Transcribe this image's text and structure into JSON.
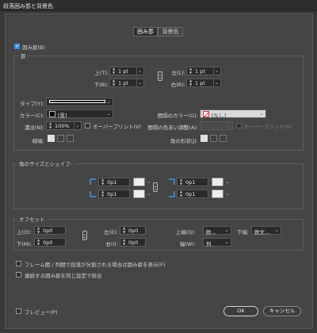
{
  "window": {
    "title": "段落囲み罫と背景色"
  },
  "tabs": [
    {
      "label": "囲み罫",
      "active": true
    },
    {
      "label": "背景色",
      "active": false
    }
  ],
  "border": {
    "checkbox_label": "囲み罫(B)",
    "checked": true,
    "section_label": "罫",
    "top_label": "上(T):",
    "top_value": "1 pt",
    "bottom_label": "下(B):",
    "bottom_value": "1 pt",
    "left_label": "左(L):",
    "left_value": "1 pt",
    "right_label": "右(R):",
    "right_value": "1 pt",
    "type_label": "タイプ(Y):",
    "color_label": "カラー(C):",
    "color_value": "[黒]",
    "tint_label": "濃淡(N):",
    "tint_value": "100%",
    "overprint_label": "オーバープリント(V)",
    "weight_label": "線端:",
    "gap_color_label": "間隔のカラー(G):",
    "gap_color_value": "[なし]",
    "gap_tint_label": "間隔の色あい調整(A):",
    "gap_overprint_label": "オーバープリント(R)",
    "corner_join_label": "角の形状(J):"
  },
  "corner": {
    "section_label": "角のサイズとシェイプ:",
    "top_left_value": "0p1",
    "top_right_value": "0p1",
    "bottom_left_value": "0p1",
    "bottom_right_value": "0p1"
  },
  "offset": {
    "section_label": "オフセット",
    "top_label": "上(O):",
    "top_value": "0p0",
    "bottom_label": "下(M):",
    "bottom_value": "0p0",
    "left_label": "左(E):",
    "left_value": "0p0",
    "right_label": "右(I):",
    "right_value": "0p0",
    "top_edge_label": "上端(Q):",
    "top_edge_value": "欧...",
    "bottom_edge_label": "下端:",
    "bottom_edge_value": "欧文...",
    "width_label": "幅(W):",
    "width_value": "列"
  },
  "options": {
    "display_across_frames_label": "フレーム間 / 列間で段落が分割される場合は囲み罫を表示(F)",
    "merge_consecutive_label": "連続する囲み罫を同じ設定で結合"
  },
  "footer": {
    "preview_label": "プレビュー(P)",
    "ok_label": "OK",
    "cancel_label": "キャンセル"
  },
  "colors": {
    "accent": "#3a8eed",
    "background": "#444444",
    "field_background": "#2a2a2a"
  }
}
